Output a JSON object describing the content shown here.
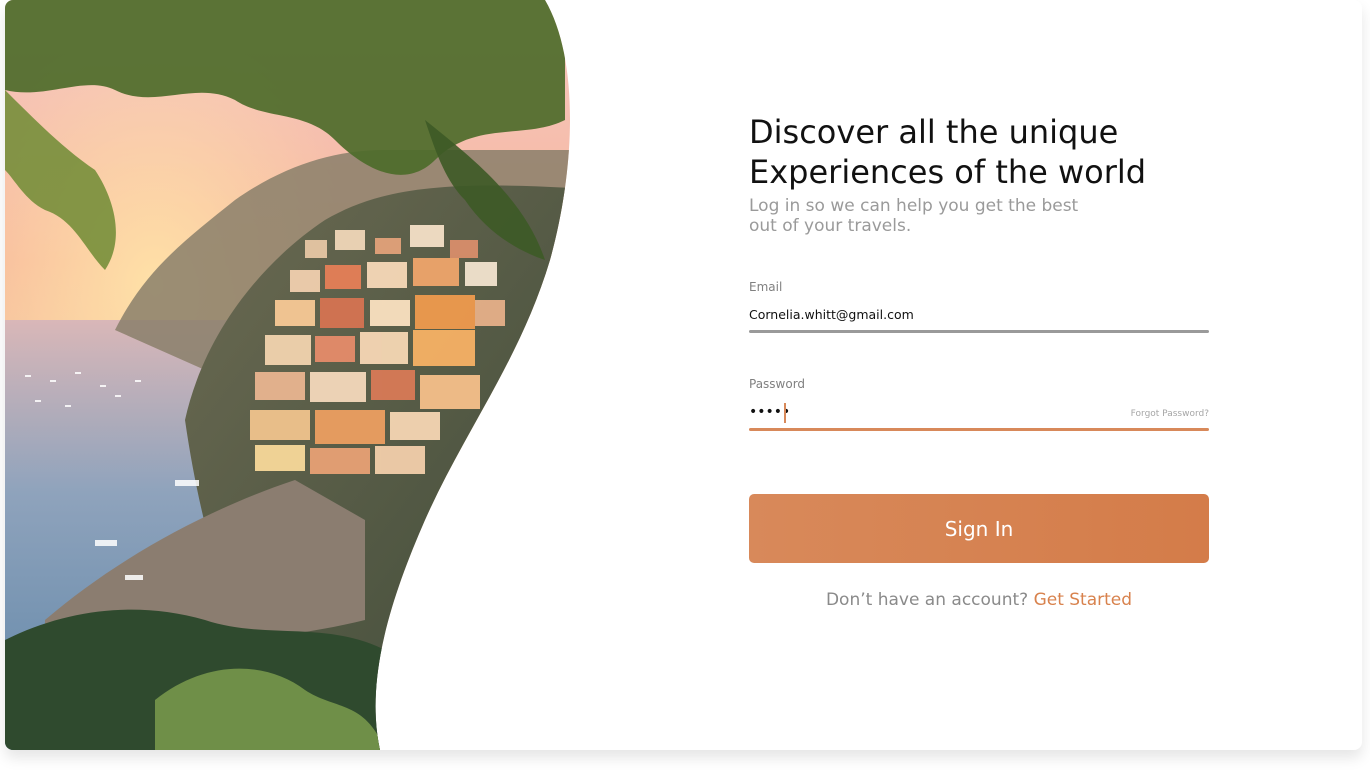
{
  "hero": {
    "image": "coastal-cliffside-village-at-sunset"
  },
  "headline": {
    "line1": "Discover all the unique",
    "line2": "Experiences of the world"
  },
  "subtitle": "Log in so we can help you get the best out of your travels.",
  "email": {
    "label": "Email",
    "value": "Cornelia.whitt@gmail.com"
  },
  "password": {
    "label": "Password",
    "value": "•••••",
    "forgot_label": "Forgot Password?"
  },
  "signin": {
    "label": "Sign In"
  },
  "signup": {
    "prompt": "Don’t have an account?",
    "link_label": "Get Started"
  },
  "colors": {
    "accent": "#d8895a",
    "heading": "#111111",
    "muted": "#9a9a9a"
  }
}
